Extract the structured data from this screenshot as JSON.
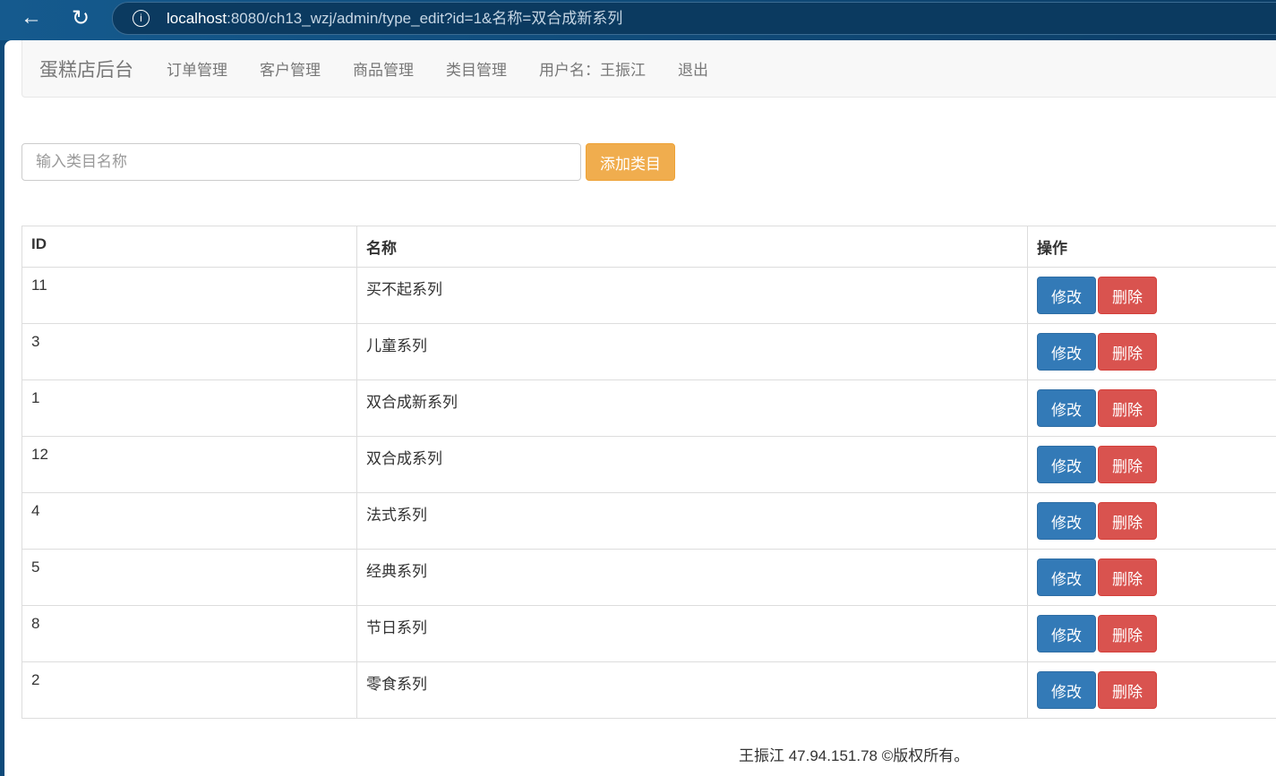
{
  "browser": {
    "url_host": "localhost",
    "url_path": ":8080/ch13_wzj/admin/type_edit?id=1&名称=双合成新系列"
  },
  "navbar": {
    "brand": "蛋糕店后台",
    "links": [
      "订单管理",
      "客户管理",
      "商品管理",
      "类目管理",
      "用户名：王振江",
      "退出"
    ]
  },
  "form": {
    "placeholder": "输入类目名称",
    "add_label": "添加类目"
  },
  "table": {
    "headers": [
      "ID",
      "名称",
      "操作"
    ],
    "edit_label": "修改",
    "delete_label": "删除",
    "rows": [
      {
        "id": "11",
        "name": "买不起系列"
      },
      {
        "id": "3",
        "name": "儿童系列"
      },
      {
        "id": "1",
        "name": "双合成新系列"
      },
      {
        "id": "12",
        "name": "双合成系列"
      },
      {
        "id": "4",
        "name": "法式系列"
      },
      {
        "id": "5",
        "name": "经典系列"
      },
      {
        "id": "8",
        "name": "节日系列"
      },
      {
        "id": "2",
        "name": "零食系列"
      }
    ]
  },
  "footer": "王振江 47.94.151.78 ©版权所有。"
}
